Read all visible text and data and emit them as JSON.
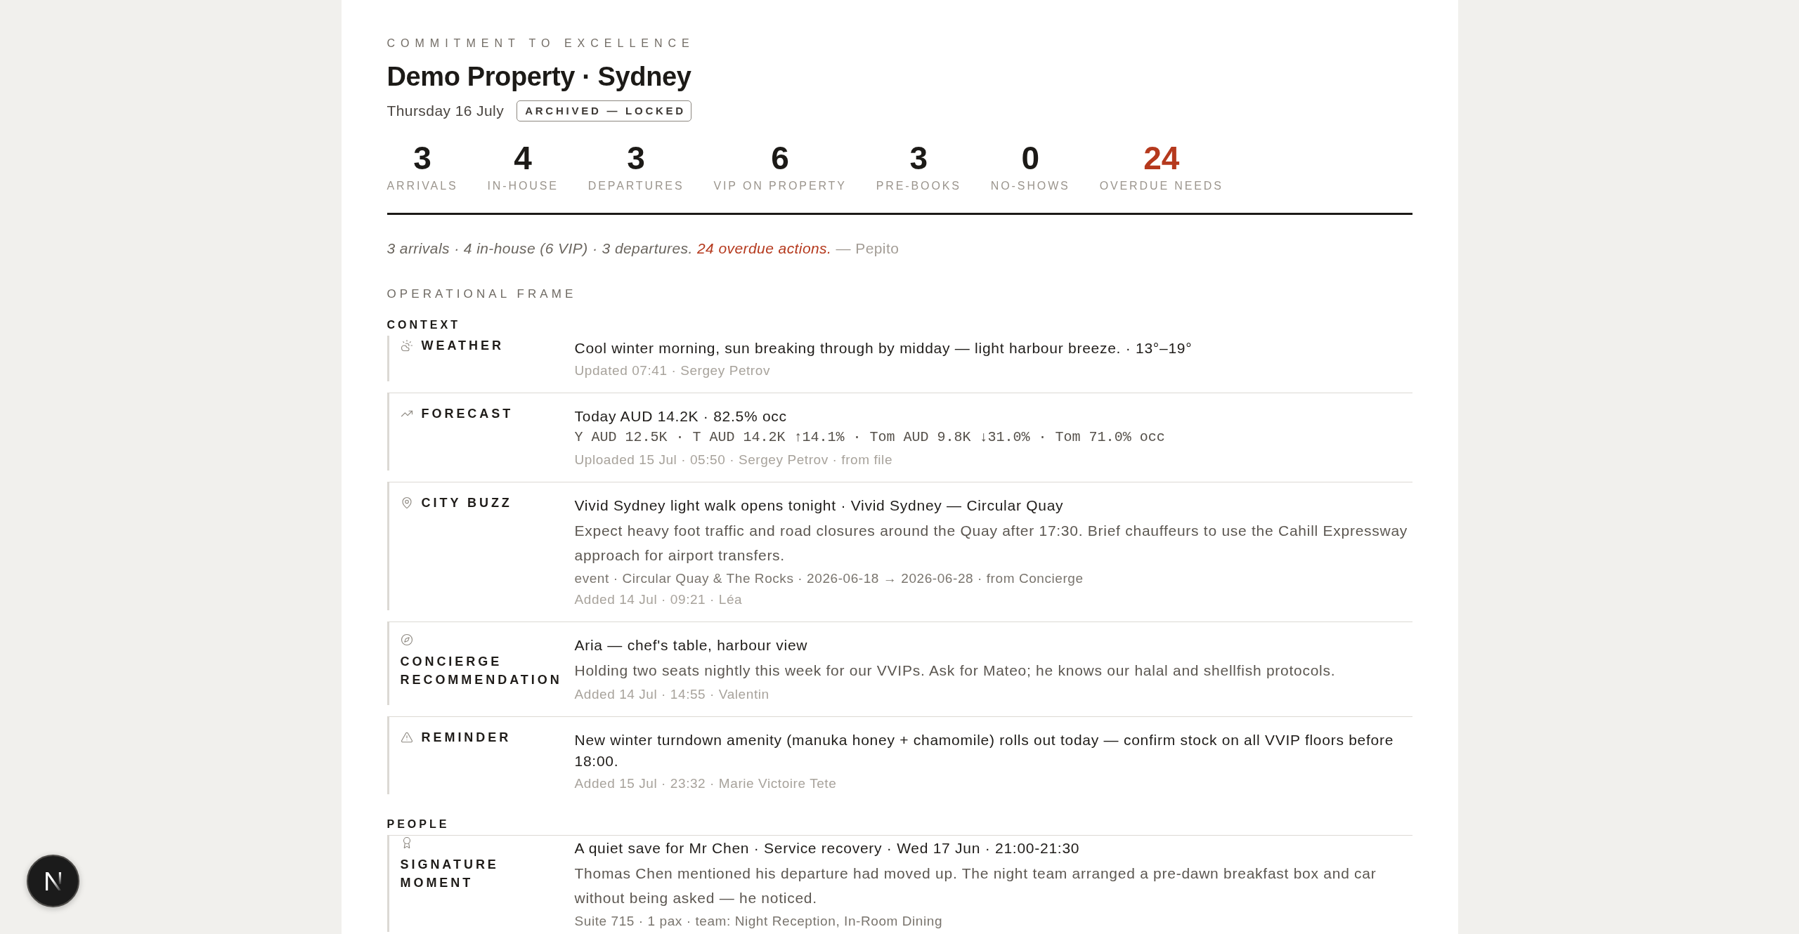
{
  "header": {
    "eyebrow": "COMMITMENT TO EXCELLENCE",
    "title": "Demo Property · Sydney",
    "date": "Thursday 16 July",
    "status_badge": "ARCHIVED — LOCKED"
  },
  "stats": [
    {
      "value": "3",
      "label": "ARRIVALS",
      "alert": false
    },
    {
      "value": "4",
      "label": "IN-HOUSE",
      "alert": false
    },
    {
      "value": "3",
      "label": "DEPARTURES",
      "alert": false
    },
    {
      "value": "6",
      "label": "VIP ON PROPERTY",
      "alert": false
    },
    {
      "value": "3",
      "label": "PRE-BOOKS",
      "alert": false
    },
    {
      "value": "0",
      "label": "NO-SHOWS",
      "alert": false
    },
    {
      "value": "24",
      "label": "OVERDUE NEEDS",
      "alert": true
    }
  ],
  "summary": {
    "text": "3 arrivals · 4 in-house (6 VIP) · 3 departures.",
    "alert": "24 overdue actions.",
    "attribution": "— Pepito"
  },
  "operational_frame": {
    "title": "OPERATIONAL FRAME",
    "sections": [
      {
        "title": "CONTEXT",
        "items": [
          {
            "kind": "weather",
            "label": "WEATHER",
            "headline": "Cool winter morning, sun breaking through by midday — light harbour breeze. · 13°–19°",
            "meta": "Updated 07:41 · Sergey Petrov"
          },
          {
            "kind": "forecast",
            "label": "FORECAST",
            "headline": "Today AUD 14.2K · 82.5% occ",
            "figures": "Y AUD 12.5K · T AUD 14.2K ↑14.1% · Tom AUD 9.8K ↓31.0% · Tom 71.0% occ",
            "meta": "Uploaded 15 Jul · 05:50 · Sergey Petrov · from file"
          },
          {
            "kind": "city_buzz",
            "label": "CITY BUZZ",
            "headline": "Vivid Sydney light walk opens tonight · Vivid Sydney — Circular Quay",
            "body": "Expect heavy foot traffic and road closures around the Quay after 17:30. Brief chauffeurs to use the Cahill Expressway approach for airport transfers.",
            "details": "event · Circular Quay & The Rocks · 2026-06-18 → 2026-06-28 · from Concierge",
            "meta": "Added 14 Jul · 09:21 · Léa"
          },
          {
            "kind": "concierge",
            "label": "CONCIERGE RECOMMENDATION",
            "headline": "Aria — chef's table, harbour view",
            "body": "Holding two seats nightly this week for our VVIPs. Ask for Mateo; he knows our halal and shellfish protocols.",
            "meta": "Added 14 Jul · 14:55 · Valentin"
          },
          {
            "kind": "reminder",
            "label": "REMINDER",
            "headline": "New winter turndown amenity (manuka honey + chamomile) rolls out today — confirm stock on all VVIP floors before 18:00.",
            "meta": "Added 15 Jul · 23:32 · Marie Victoire Tete"
          }
        ]
      },
      {
        "title": "PEOPLE",
        "items": [
          {
            "kind": "signature",
            "label": "SIGNATURE MOMENT",
            "headline": "A quiet save for Mr Chen · Service recovery · Wed 17 Jun · 21:00-21:30",
            "body": "Thomas Chen mentioned his departure had moved up. The night team arranged a pre-dawn breakfast box and car without being asked — he noticed.",
            "details": "Suite 715 · 1 pax · team: Night Reception, In-Room Dining"
          }
        ]
      }
    ]
  }
}
